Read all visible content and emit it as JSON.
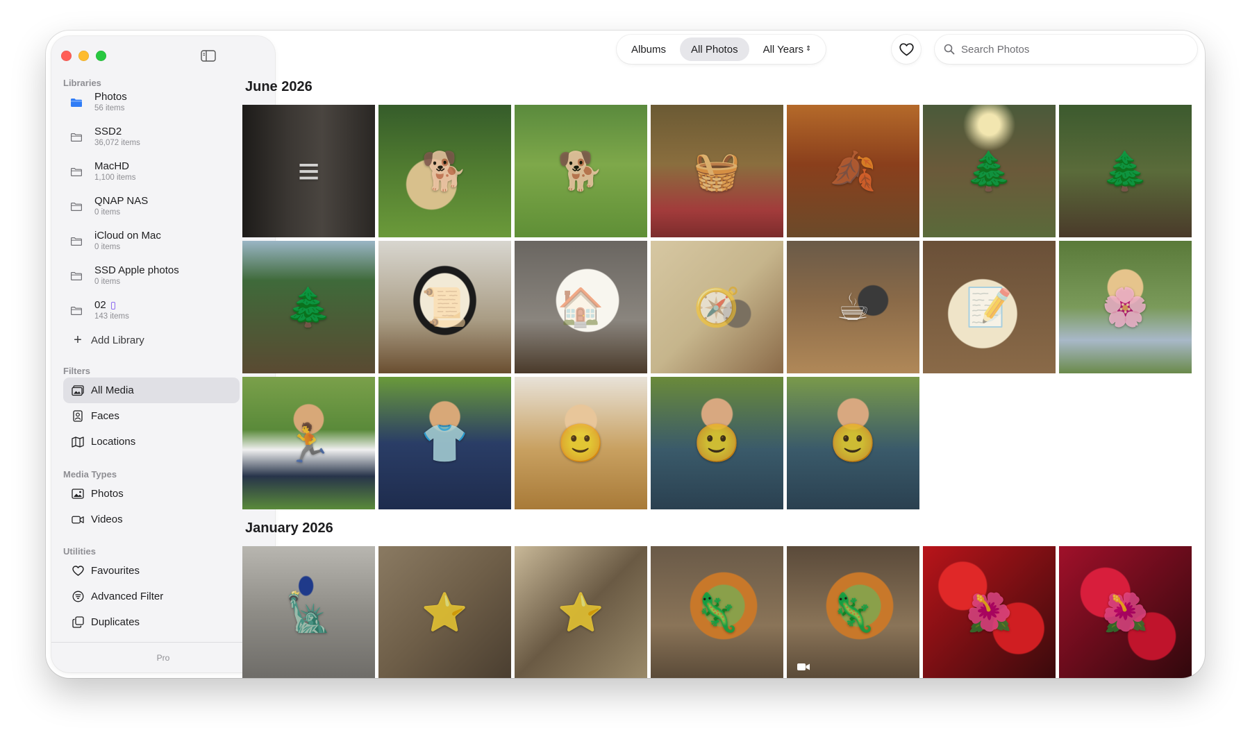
{
  "sidebar": {
    "libraries_title": "Libraries",
    "libraries": [
      {
        "name": "Photos",
        "count": "56 items",
        "icon": "folder-filled-icon",
        "color": "#2f7cf6"
      },
      {
        "name": "SSD2",
        "count": "36,072 items",
        "icon": "folder-icon"
      },
      {
        "name": "MacHD",
        "count": "1,100 items",
        "icon": "folder-icon"
      },
      {
        "name": "QNAP NAS",
        "count": "0 items",
        "icon": "folder-icon"
      },
      {
        "name": "iCloud on Mac",
        "count": "0 items",
        "icon": "folder-icon"
      },
      {
        "name": "SSD Apple photos",
        "count": "0 items",
        "icon": "folder-icon"
      },
      {
        "name": "02",
        "count": "143 items",
        "icon": "folder-icon"
      }
    ],
    "add_library": "Add Library",
    "filters_title": "Filters",
    "filters": [
      {
        "label": "All Media",
        "icon": "photo-stack-icon",
        "active": true
      },
      {
        "label": "Faces",
        "icon": "faces-icon"
      },
      {
        "label": "Locations",
        "icon": "map-icon"
      }
    ],
    "media_types_title": "Media Types",
    "media_types": [
      {
        "label": "Photos",
        "icon": "photo-icon"
      },
      {
        "label": "Videos",
        "icon": "video-icon"
      }
    ],
    "utilities_title": "Utilities",
    "utilities": [
      {
        "label": "Favourites",
        "icon": "heart-icon"
      },
      {
        "label": "Advanced Filter",
        "icon": "filter-icon"
      },
      {
        "label": "Duplicates",
        "icon": "duplicates-icon"
      }
    ],
    "footer": "Pro"
  },
  "toolbar": {
    "segments": [
      {
        "label": "Albums",
        "active": false
      },
      {
        "label": "All Photos",
        "active": true
      },
      {
        "label": "All Years",
        "active": false
      }
    ],
    "search_placeholder": "Search Photos"
  },
  "sections": [
    {
      "title": "June 2026",
      "photos": [
        {
          "subject": "safety-rules-sign",
          "glyph": "≡"
        },
        {
          "subject": "girl-with-golden-retriever",
          "glyph": "🐕"
        },
        {
          "subject": "kids-running-with-dog",
          "glyph": "🐕"
        },
        {
          "subject": "family-picnic",
          "glyph": "🧺"
        },
        {
          "subject": "family-autumn-forest",
          "glyph": "🍂"
        },
        {
          "subject": "kids-forest-path",
          "glyph": "🌲"
        },
        {
          "subject": "family-on-log",
          "glyph": "🌲"
        },
        {
          "subject": "family-hiking-trail",
          "glyph": "🌲"
        },
        {
          "subject": "certificate-of-achievement",
          "glyph": "📜"
        },
        {
          "subject": "child-drawing-house",
          "glyph": "🏠"
        },
        {
          "subject": "paris-map-compass",
          "glyph": "🧭"
        },
        {
          "subject": "cafe-coffee-receipt",
          "glyph": "☕"
        },
        {
          "subject": "handwritten-recipe",
          "glyph": "📝"
        },
        {
          "subject": "girl-in-garden",
          "glyph": "🌸"
        },
        {
          "subject": "boy-running",
          "glyph": "🏃"
        },
        {
          "subject": "boy-urban-adventure-shirt",
          "glyph": "👕"
        },
        {
          "subject": "woman-smiling",
          "glyph": "🙂"
        },
        {
          "subject": "man-plaid-shirt",
          "glyph": "🙂"
        },
        {
          "subject": "man-plaid-shirt-2",
          "glyph": "🙂"
        }
      ]
    },
    {
      "title": "January 2026",
      "photos": [
        {
          "subject": "manneken-pis-statue",
          "glyph": "🗽"
        },
        {
          "subject": "starfish-pair",
          "glyph": "⭐"
        },
        {
          "subject": "starfish-sand",
          "glyph": "⭐"
        },
        {
          "subject": "iguana",
          "glyph": "🦎"
        },
        {
          "subject": "iguana-video",
          "glyph": "🦎",
          "video": true
        },
        {
          "subject": "red-dahlias",
          "glyph": "🌺"
        },
        {
          "subject": "red-chrysanthemums",
          "glyph": "🌺"
        }
      ]
    }
  ]
}
